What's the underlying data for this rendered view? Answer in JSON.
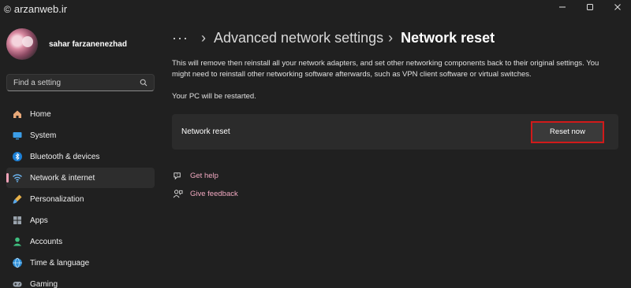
{
  "window": {
    "watermark": "arzanweb.ir",
    "watermark_symbol": "©"
  },
  "profile": {
    "name": "sahar farzanenezhad"
  },
  "search": {
    "placeholder": "Find a setting"
  },
  "sidebar": {
    "items": [
      {
        "label": "Home",
        "icon": "home-icon",
        "active": false
      },
      {
        "label": "System",
        "icon": "system-icon",
        "active": false
      },
      {
        "label": "Bluetooth & devices",
        "icon": "bluetooth-icon",
        "active": false
      },
      {
        "label": "Network & internet",
        "icon": "wifi-icon",
        "active": true
      },
      {
        "label": "Personalization",
        "icon": "brush-icon",
        "active": false
      },
      {
        "label": "Apps",
        "icon": "apps-icon",
        "active": false
      },
      {
        "label": "Accounts",
        "icon": "accounts-icon",
        "active": false
      },
      {
        "label": "Time & language",
        "icon": "globe-icon",
        "active": false
      },
      {
        "label": "Gaming",
        "icon": "gaming-icon",
        "active": false
      }
    ]
  },
  "breadcrumb": {
    "more": "···",
    "separator": "›",
    "parent": "Advanced network settings",
    "current": "Network reset"
  },
  "content": {
    "description": "This will remove then reinstall all your network adapters, and set other networking components back to their original settings. You might need to reinstall other networking software afterwards, such as VPN client software or virtual switches.",
    "restart_note": "Your PC will be restarted.",
    "card_label": "Network reset",
    "reset_button": "Reset now",
    "links": [
      {
        "label": "Get help",
        "icon": "help-icon"
      },
      {
        "label": "Give feedback",
        "icon": "feedback-icon"
      }
    ]
  },
  "colors": {
    "accent": "#f0a2b8",
    "highlight_border": "#d11a1a",
    "background": "#202020"
  }
}
